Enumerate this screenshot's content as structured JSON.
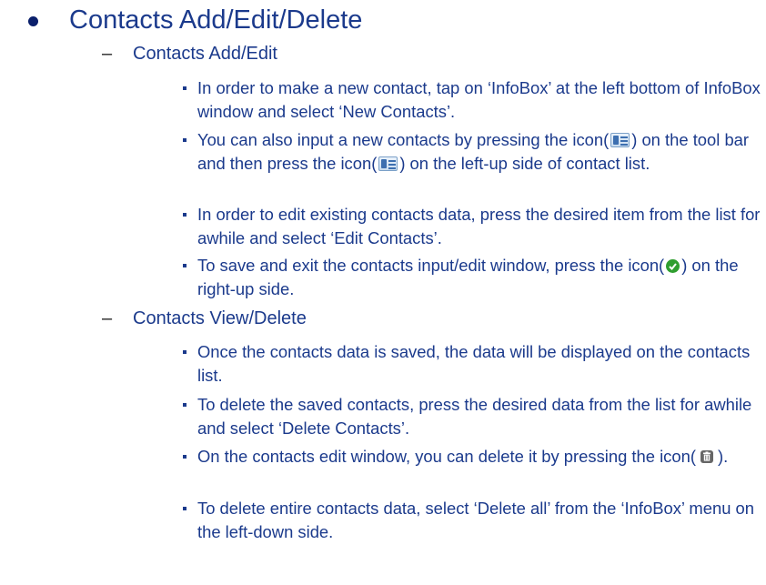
{
  "slide": {
    "heading": "Contacts Add/Edit/Delete",
    "sections": [
      {
        "title": "Contacts Add/Edit",
        "items": [
          {
            "parts": [
              "In order to make a new contact, tap on ‘InfoBox’ at the left bottom of InfoBox window and select ‘New Contacts’."
            ]
          },
          {
            "parts": [
              "You can also input a new contacts by pressing the icon(",
              ") on the tool bar and then press the icon(",
              ") on the left-up side of contact list."
            ]
          },
          {
            "parts": [
              "In order to edit existing contacts data, press the desired item from the list for awhile and select ‘Edit Contacts’."
            ]
          },
          {
            "parts": [
              "To save and exit the contacts input/edit window, press the icon(",
              ") on the right-up side."
            ]
          }
        ]
      },
      {
        "title": "Contacts View/Delete",
        "items": [
          {
            "parts": [
              "Once the contacts data is saved, the data will be displayed on the contacts list."
            ]
          },
          {
            "parts": [
              "To delete the saved contacts, press the desired data from the list for awhile and select ‘Delete Contacts’."
            ]
          },
          {
            "parts": [
              "On the contacts edit window, you can delete it by pressing the icon(",
              ")."
            ]
          },
          {
            "parts": [
              "To delete entire contacts data, select ‘Delete all’ from the ‘InfoBox’ menu on the left-down side."
            ]
          }
        ]
      }
    ]
  },
  "icons": {
    "contact_card": "contact-card-icon",
    "save_check": "save-check-icon",
    "trash": "trash-icon"
  },
  "colors": {
    "text": "#1b3a8c",
    "bullet": "#0a1f6b",
    "check": "#2f9e2f"
  }
}
